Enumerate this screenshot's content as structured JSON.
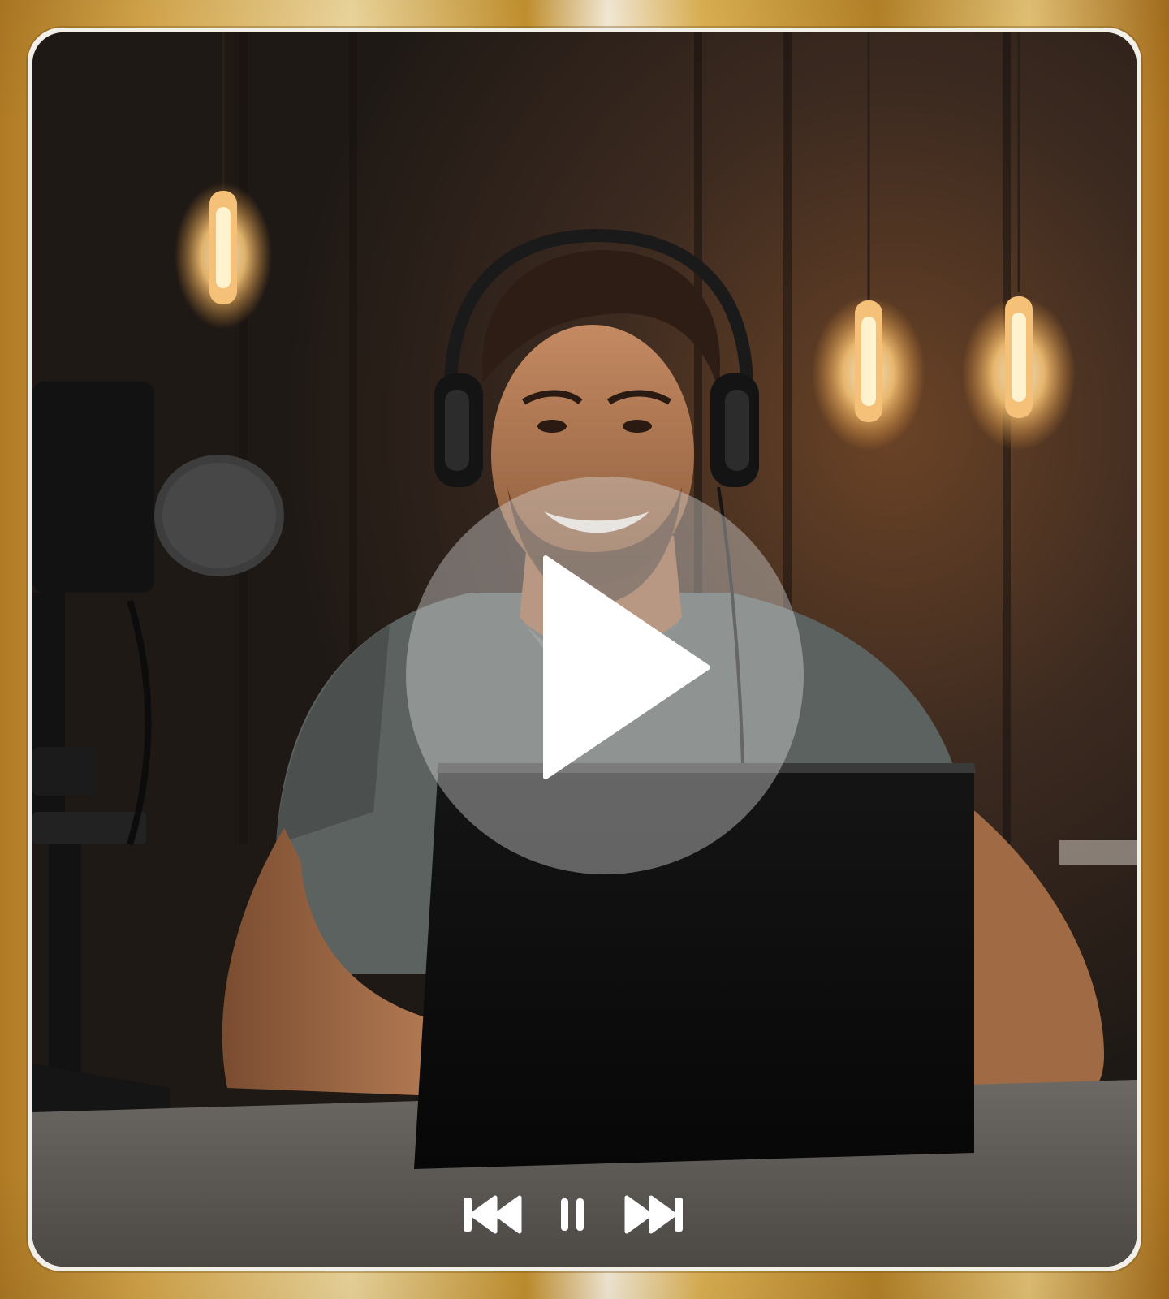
{
  "player": {
    "frame_colors": {
      "gold_dark": "#b07a24",
      "gold_light": "#fbf1dc",
      "rim": "#f2efe8"
    },
    "overlay": {
      "icon": "play-icon",
      "circle_color": "#d7d7d7",
      "icon_color": "#ffffff"
    },
    "controls": [
      {
        "icon": "skip-back-icon"
      },
      {
        "icon": "pause-icon"
      },
      {
        "icon": "skip-forward-icon"
      }
    ]
  }
}
